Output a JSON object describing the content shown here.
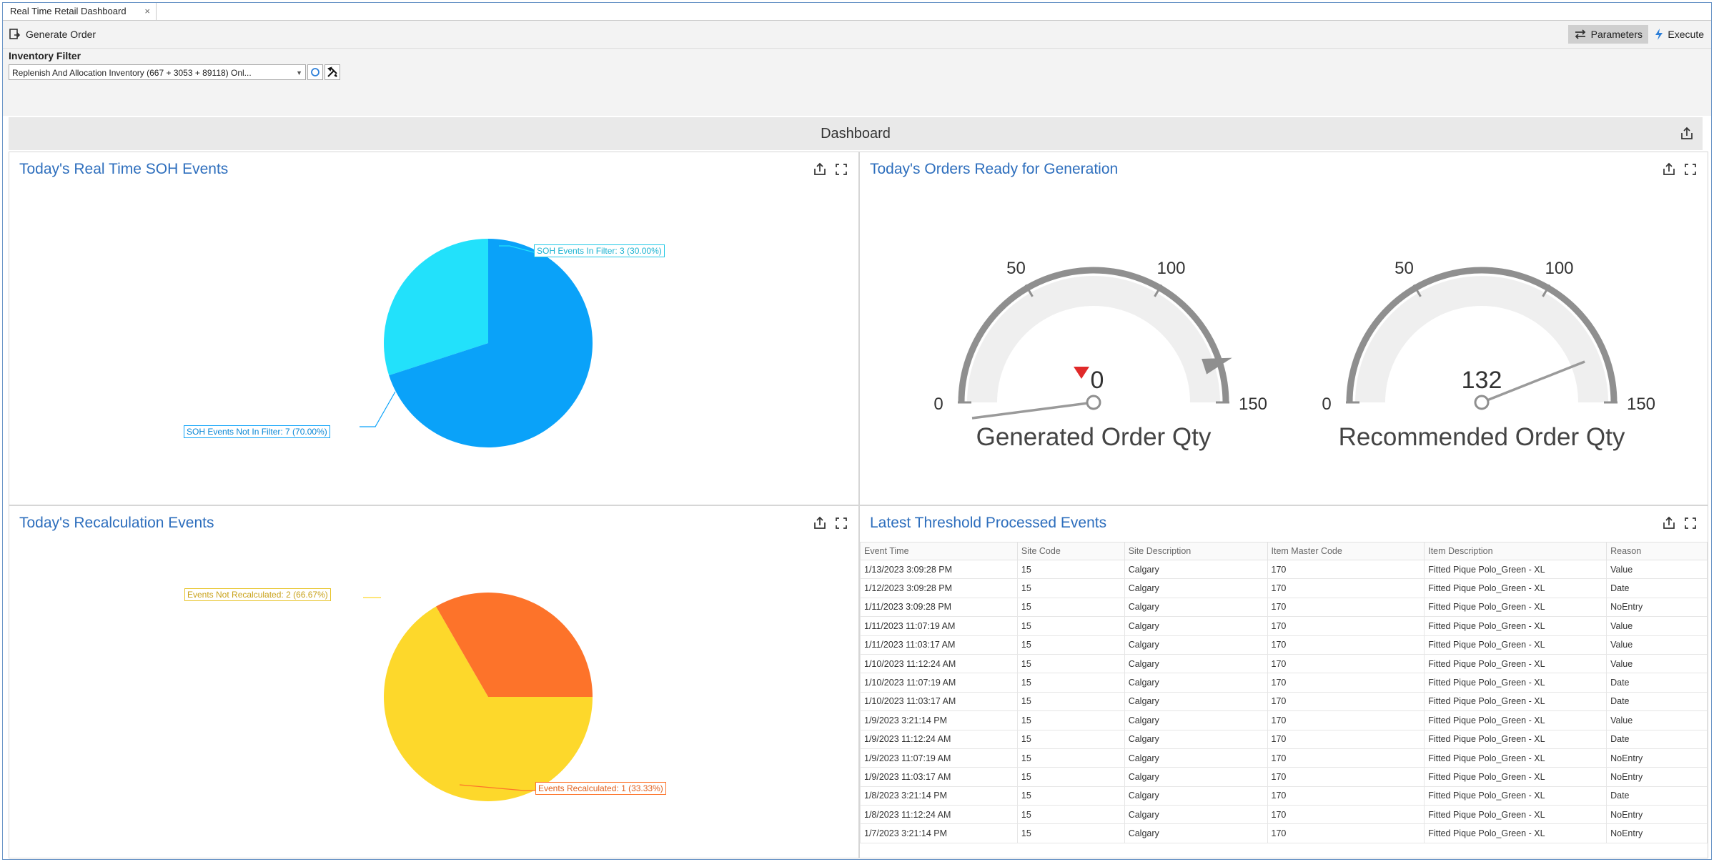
{
  "window": {
    "tab_title": "Real Time Retail Dashboard",
    "tab_close": "×"
  },
  "toolbar": {
    "generate_order": "Generate Order",
    "parameters": "Parameters",
    "execute": "Execute"
  },
  "filter": {
    "label": "Inventory Filter",
    "value": "Replenish And Allocation Inventory (667 + 3053 + 89118) Onl..."
  },
  "dashboard": {
    "title": "Dashboard"
  },
  "soh_panel": {
    "title": "Today's Real Time SOH Events",
    "chart_data": {
      "type": "pie",
      "categories": [
        "SOH Events In Filter",
        "SOH Events Not In Filter"
      ],
      "values": [
        3,
        7
      ],
      "labels": [
        "SOH Events In Filter: 3 (30.00%)",
        "SOH Events Not In Filter: 7 (70.00%)"
      ],
      "colors": [
        "#22e1fb",
        "#0aa2f9"
      ]
    }
  },
  "orders_panel": {
    "title": "Today's Orders Ready for Generation",
    "gauges": [
      {
        "label": "Generated Order Qty",
        "value": 0,
        "value_text": "0",
        "min": 0,
        "max": 150,
        "ticks": [
          "0",
          "50",
          "100",
          "150"
        ],
        "has_marker": true,
        "marker_value": 135
      },
      {
        "label": "Recommended Order Qty",
        "value": 132,
        "value_text": "132",
        "min": 0,
        "max": 150,
        "ticks": [
          "0",
          "50",
          "100",
          "150"
        ],
        "has_marker": false
      }
    ]
  },
  "recalc_panel": {
    "title": "Today's Recalculation Events",
    "chart_data": {
      "type": "pie",
      "categories": [
        "Events Not Recalculated",
        "Events Recalculated"
      ],
      "values": [
        2,
        1
      ],
      "labels": [
        "Events Not Recalculated: 2 (66.67%)",
        "Events Recalculated: 1 (33.33%)"
      ],
      "colors": [
        "#fdd82b",
        "#fd732a"
      ]
    }
  },
  "threshold_panel": {
    "title": "Latest Threshold Processed Events",
    "columns": [
      "Event Time",
      "Site Code",
      "Site Description",
      "Item Master Code",
      "Item Description",
      "Reason"
    ],
    "rows": [
      [
        "1/13/2023 3:09:28 PM",
        "15",
        "Calgary",
        "170",
        "Fitted Pique Polo_Green - XL",
        "Value"
      ],
      [
        "1/12/2023 3:09:28 PM",
        "15",
        "Calgary",
        "170",
        "Fitted Pique Polo_Green - XL",
        "Date"
      ],
      [
        "1/11/2023 3:09:28 PM",
        "15",
        "Calgary",
        "170",
        "Fitted Pique Polo_Green - XL",
        "NoEntry"
      ],
      [
        "1/11/2023 11:07:19 AM",
        "15",
        "Calgary",
        "170",
        "Fitted Pique Polo_Green - XL",
        "Value"
      ],
      [
        "1/11/2023 11:03:17 AM",
        "15",
        "Calgary",
        "170",
        "Fitted Pique Polo_Green - XL",
        "Value"
      ],
      [
        "1/10/2023 11:12:24 AM",
        "15",
        "Calgary",
        "170",
        "Fitted Pique Polo_Green - XL",
        "Value"
      ],
      [
        "1/10/2023 11:07:19 AM",
        "15",
        "Calgary",
        "170",
        "Fitted Pique Polo_Green - XL",
        "Date"
      ],
      [
        "1/10/2023 11:03:17 AM",
        "15",
        "Calgary",
        "170",
        "Fitted Pique Polo_Green - XL",
        "Date"
      ],
      [
        "1/9/2023 3:21:14 PM",
        "15",
        "Calgary",
        "170",
        "Fitted Pique Polo_Green - XL",
        "Value"
      ],
      [
        "1/9/2023 11:12:24 AM",
        "15",
        "Calgary",
        "170",
        "Fitted Pique Polo_Green - XL",
        "Date"
      ],
      [
        "1/9/2023 11:07:19 AM",
        "15",
        "Calgary",
        "170",
        "Fitted Pique Polo_Green - XL",
        "NoEntry"
      ],
      [
        "1/9/2023 11:03:17 AM",
        "15",
        "Calgary",
        "170",
        "Fitted Pique Polo_Green - XL",
        "NoEntry"
      ],
      [
        "1/8/2023 3:21:14 PM",
        "15",
        "Calgary",
        "170",
        "Fitted Pique Polo_Green - XL",
        "Date"
      ],
      [
        "1/8/2023 11:12:24 AM",
        "15",
        "Calgary",
        "170",
        "Fitted Pique Polo_Green - XL",
        "NoEntry"
      ],
      [
        "1/7/2023 3:21:14 PM",
        "15",
        "Calgary",
        "170",
        "Fitted Pique Polo_Green - XL",
        "NoEntry"
      ]
    ]
  },
  "colors": {
    "accent": "#2d6ebd",
    "gauge_gray": "#8f8f8f",
    "marker_red": "#e02a2a"
  }
}
